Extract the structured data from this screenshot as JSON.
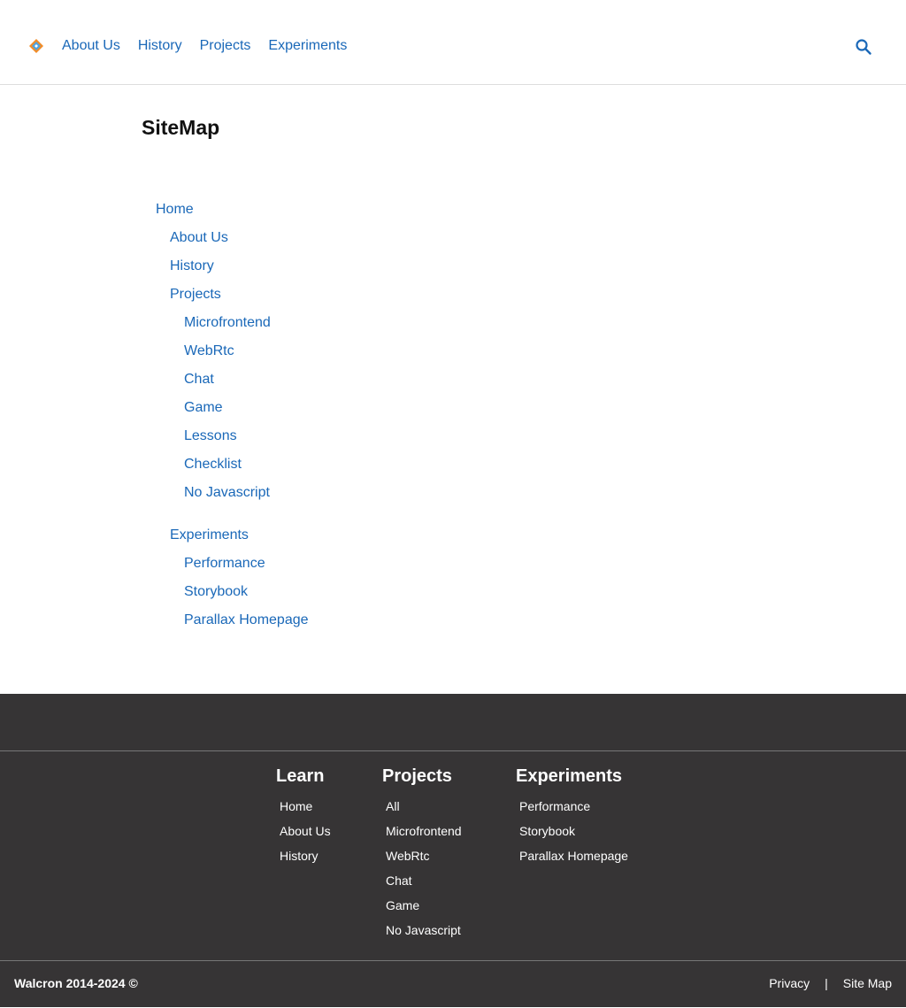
{
  "header": {
    "logo_icon": "walcron-diamond-logo",
    "nav": [
      "About Us",
      "History",
      "Projects",
      "Experiments"
    ],
    "search_icon": "search-icon"
  },
  "main": {
    "title": "SiteMap",
    "tree": {
      "home": "Home",
      "about": "About Us",
      "history": "History",
      "projects": "Projects",
      "project_items": [
        "Microfrontend",
        "WebRtc",
        "Chat",
        "Game",
        "Lessons",
        "Checklist",
        "No Javascript"
      ],
      "experiments": "Experiments",
      "experiment_items": [
        "Performance",
        "Storybook",
        "Parallax Homepage"
      ]
    }
  },
  "footer": {
    "columns": [
      {
        "title": "Learn",
        "links": [
          "Home",
          "About Us",
          "History"
        ]
      },
      {
        "title": "Projects",
        "links": [
          "All",
          "Microfrontend",
          "WebRtc",
          "Chat",
          "Game",
          "No Javascript"
        ]
      },
      {
        "title": "Experiments",
        "links": [
          "Performance",
          "Storybook",
          "Parallax Homepage"
        ]
      }
    ],
    "copyright": "Walcron 2014-2024 ©",
    "bottom_links": [
      "Privacy",
      "Site Map"
    ],
    "separator": "|"
  },
  "colors": {
    "link": "#1a68b8",
    "footer_bg": "#363435",
    "footer_text": "#ffffff"
  }
}
